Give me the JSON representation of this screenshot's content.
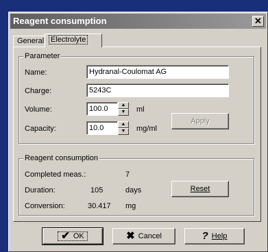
{
  "window": {
    "title": "Reagent consumption",
    "close_glyph": "✕"
  },
  "tabs": [
    {
      "label": "General",
      "active": false
    },
    {
      "label": "Electrolyte",
      "active": true
    }
  ],
  "parameter": {
    "group_label": "Parameter",
    "name_label": "Name:",
    "name_value": "Hydranal-Coulomat AG",
    "charge_label": "Charge:",
    "charge_value": "5243C",
    "volume_label": "Volume:",
    "volume_value": "100.0",
    "volume_unit": "ml",
    "capacity_label": "Capacity:",
    "capacity_value": "10.0",
    "capacity_unit": "mg/ml",
    "apply_label": "Apply"
  },
  "consumption": {
    "group_label": "Reagent consumption",
    "completed_label": "Completed meas.:",
    "completed_value": "7",
    "duration_label": "Duration:",
    "duration_value": "105",
    "duration_unit": "days",
    "conversion_label": "Conversion:",
    "conversion_value": "30.417",
    "conversion_unit": "mg",
    "reset_label": "Reset"
  },
  "footer": {
    "ok_label": "OK",
    "ok_icon": "check-icon",
    "cancel_label": "Cancel",
    "cancel_icon": "x-icon",
    "help_label": "Help",
    "help_icon": "question-icon"
  },
  "colors": {
    "desktop": "#1a2f7a",
    "dialog": "#d4d0c8",
    "title_gradient_start": "#5e5e5e"
  }
}
